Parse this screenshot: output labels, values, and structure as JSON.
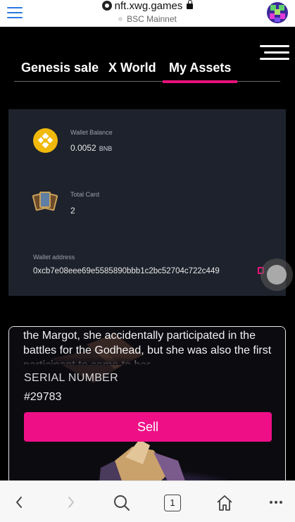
{
  "browser": {
    "url": "nft.xwg.games",
    "network": "BSC Mainnet",
    "tab_count": "1"
  },
  "nav": {
    "tabs": [
      {
        "label": "Genesis sale",
        "active": false
      },
      {
        "label": "X World",
        "active": false
      },
      {
        "label": "My Assets",
        "active": true
      }
    ]
  },
  "assets": {
    "wallet_balance": {
      "label": "Wallet Balance",
      "value": "0.0052",
      "unit": "BNB"
    },
    "total_card": {
      "label": "Total Card",
      "value": "2"
    },
    "wallet_address": {
      "label": "Wallet address",
      "value": "0xcb7e08eee69e5585890bbb1c2bc52704c722c449"
    }
  },
  "nft": {
    "description": "the Margot, she accidentally participated in the battles for the Godhead, but she was also the first participant to come to her",
    "serial_label": "SERIAL NUMBER",
    "serial_value": "#29783",
    "sell_label": "Sell"
  },
  "colors": {
    "accent": "#e8127b",
    "panel": "#1e222c",
    "bnb": "#f0b90b",
    "link_blue": "#2a7ae2"
  },
  "icons": [
    "menu-icon",
    "site-icon",
    "lock-icon",
    "avatar",
    "hamburger-icon",
    "bnb-icon",
    "cards-icon",
    "copy-icon",
    "back-icon",
    "forward-icon",
    "search-icon",
    "tabs-icon",
    "home-icon",
    "more-icon"
  ]
}
